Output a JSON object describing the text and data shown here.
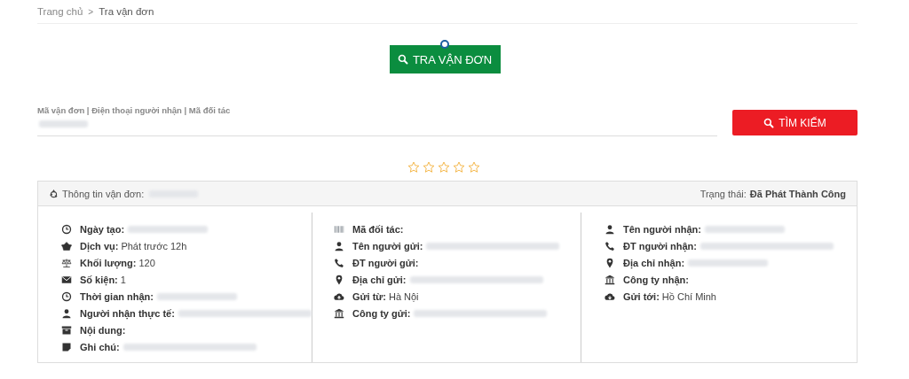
{
  "breadcrumb": [
    {
      "label": "Trang chủ"
    },
    {
      "separator": ">"
    },
    {
      "label": "Tra vận đơn"
    }
  ],
  "lookup_button": {
    "label": "TRA VẬN ĐƠN"
  },
  "search": {
    "label": "Mã vận đơn | Điện thoại người nhận | Mã đối tác",
    "blurred": true
  },
  "search_button": {
    "label": "TÌM KIẾM"
  },
  "rating": {
    "stars": 0
  },
  "panel": {
    "title": "Thông tin vận đơn:",
    "title_blurred": true,
    "status_label": "Trạng thái:",
    "status": "Đã Phát Thành Công",
    "columns": [
      [
        {
          "label": "Ngày tạo:",
          "blurred": true
        },
        {
          "label": "Dịch vụ:",
          "value": "Phát trước 12h"
        },
        {
          "label": "Khối lượng:",
          "value": "120"
        },
        {
          "label": "Số kiện:",
          "value": "1"
        },
        {
          "label": "Thời gian nhận:",
          "blurred": true
        },
        {
          "label": "Người nhận thực tế:",
          "blurred": true
        },
        {
          "label": "Nội dung:"
        },
        {
          "label": "Ghi chú:",
          "blurred": true
        }
      ],
      [
        {
          "label": "Mã đối tác:"
        },
        {
          "label": "Tên người gửi:",
          "blurred": true
        },
        {
          "label": "ĐT người gửi:"
        },
        {
          "label": "Địa chỉ gửi:",
          "blurred": true
        },
        {
          "label": "Gửi từ:",
          "value": "Hà Nội"
        },
        {
          "label": "Công ty gửi:",
          "blurred": true
        }
      ],
      [
        {
          "label": "Tên người nhận:",
          "blurred": true
        },
        {
          "label": "ĐT người nhận:",
          "blurred": true
        },
        {
          "label": "Địa chỉ nhận:",
          "blurred": true
        },
        {
          "label": "Công ty nhận:"
        },
        {
          "label": "Gửi tới:",
          "value": "Hồ Chí Minh"
        }
      ]
    ]
  }
}
